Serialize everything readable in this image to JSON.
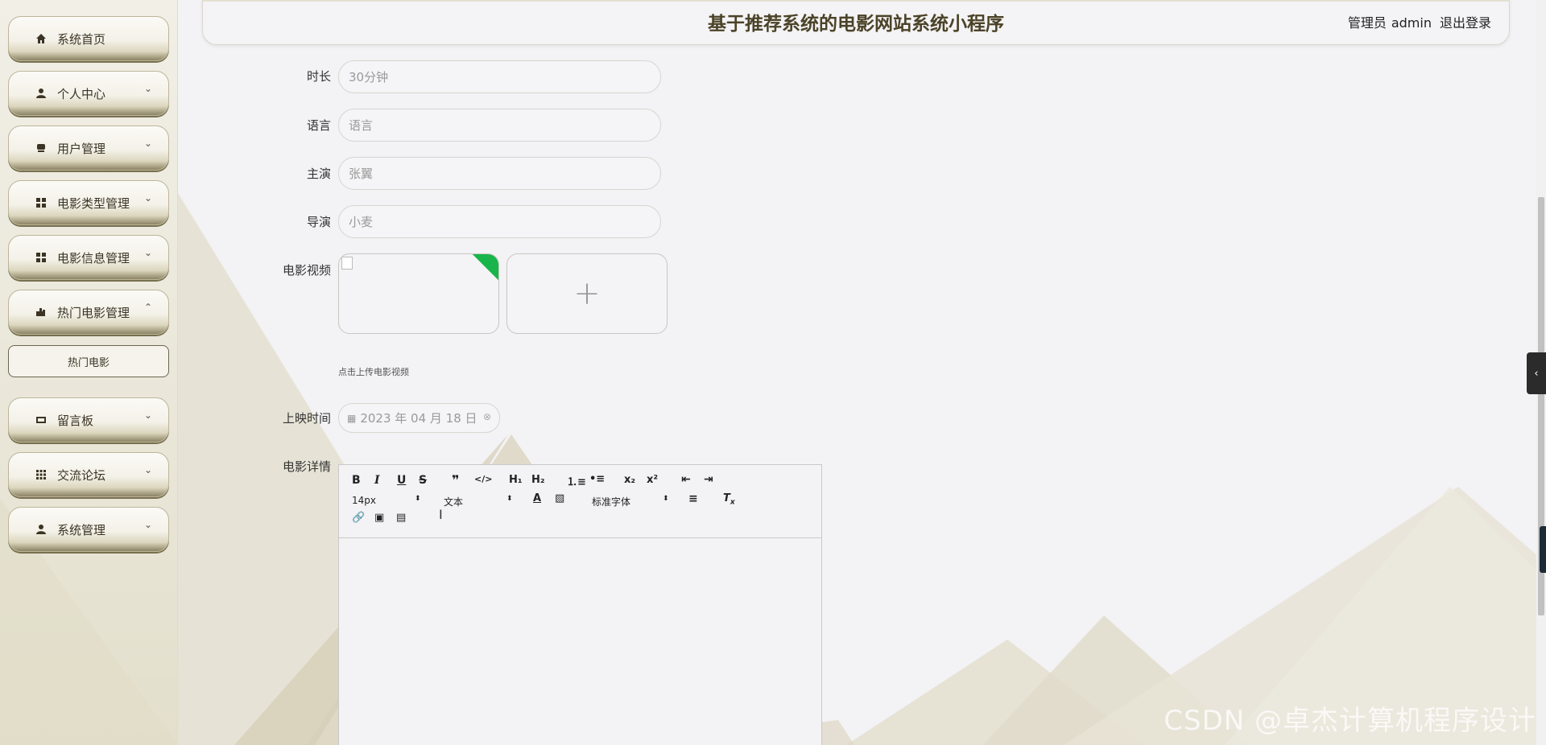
{
  "app": {
    "title": "基于推荐系统的电影网站系统小程序",
    "user_role": "管理员",
    "user_name": "admin",
    "logout": "退出登录"
  },
  "sidebar": {
    "items": [
      {
        "label": "系统首页",
        "icon": "home-icon",
        "chevron": ""
      },
      {
        "label": "个人中心",
        "icon": "user-icon",
        "chevron": "⌄"
      },
      {
        "label": "用户管理",
        "icon": "users-icon",
        "chevron": "⌄"
      },
      {
        "label": "电影类型管理",
        "icon": "grid-icon",
        "chevron": "⌄"
      },
      {
        "label": "电影信息管理",
        "icon": "grid-icon",
        "chevron": "⌄"
      },
      {
        "label": "热门电影管理",
        "icon": "fire-icon",
        "chevron": "⌃"
      },
      {
        "label": "留言板",
        "icon": "message-icon",
        "chevron": "⌄"
      },
      {
        "label": "交流论坛",
        "icon": "apps-icon",
        "chevron": "⌄"
      },
      {
        "label": "系统管理",
        "icon": "settings-user-icon",
        "chevron": "⌄"
      }
    ],
    "submenu_item": "热门电影"
  },
  "form": {
    "duration": {
      "label": "时长",
      "value": "30分钟"
    },
    "language": {
      "label": "语言",
      "value": "语言"
    },
    "actor": {
      "label": "主演",
      "value": "张翼"
    },
    "director": {
      "label": "导演",
      "value": "小麦"
    },
    "video": {
      "label": "电影视频",
      "tip": "点击上传电影视频",
      "add": "+"
    },
    "release": {
      "label": "上映时间",
      "value": "2023 年 04 月 18 日"
    },
    "details": {
      "label": "电影详情"
    }
  },
  "editor": {
    "font_size": "14px",
    "paragraph": "文本",
    "font_family": "标准字体"
  },
  "watermark": "CSDN @卓杰计算机程序设计"
}
